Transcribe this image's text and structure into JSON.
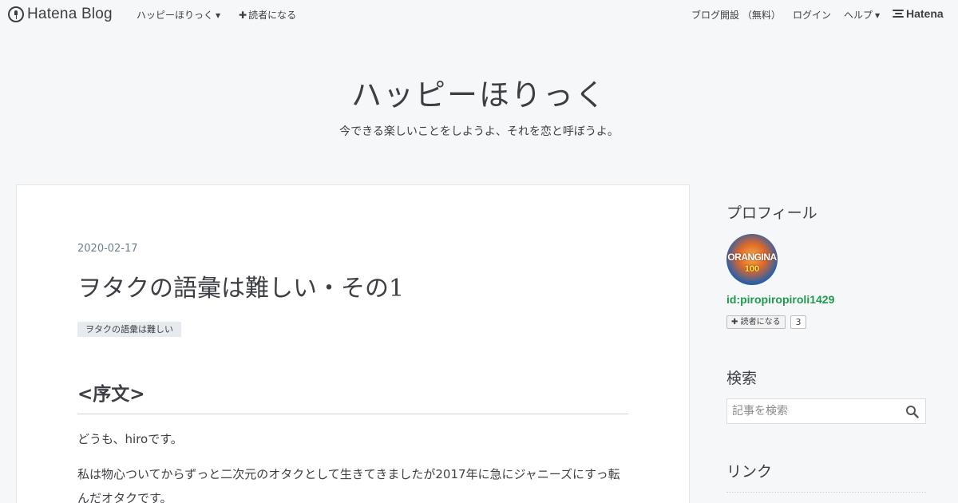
{
  "topbar": {
    "brand": "Hatena Blog",
    "blog_menu": "ハッピーほりっく",
    "subscribe": "読者になる",
    "open_blog": "ブログ開設 （無料）",
    "login": "ログイン",
    "help": "ヘルプ",
    "hatena": "Hatena"
  },
  "header": {
    "title": "ハッピーほりっく",
    "description": "今できる楽しいことをしようよ、それを恋と呼ぼうよ。"
  },
  "article": {
    "date": "2020-02-17",
    "title": "ヲタクの語彙は難しい・その1",
    "category": "ヲタクの語彙は難しい",
    "section_heading": "<序文>",
    "paragraphs": [
      "どうも、hiroです。",
      "私は物心ついてからずっと二次元のオタクとして生きてきましたが2017年に急にジャニーズにすっ転んだオタクです。"
    ]
  },
  "sidebar": {
    "profile_heading": "プロフィール",
    "avatar_text_1": "ORANGINA",
    "avatar_text_2": "100",
    "profile_id": "id:piropiropiroli1429",
    "follow_label": "読者になる",
    "follow_count": "3",
    "search_heading": "検索",
    "search_placeholder": "記事を検索",
    "links_heading": "リンク"
  }
}
